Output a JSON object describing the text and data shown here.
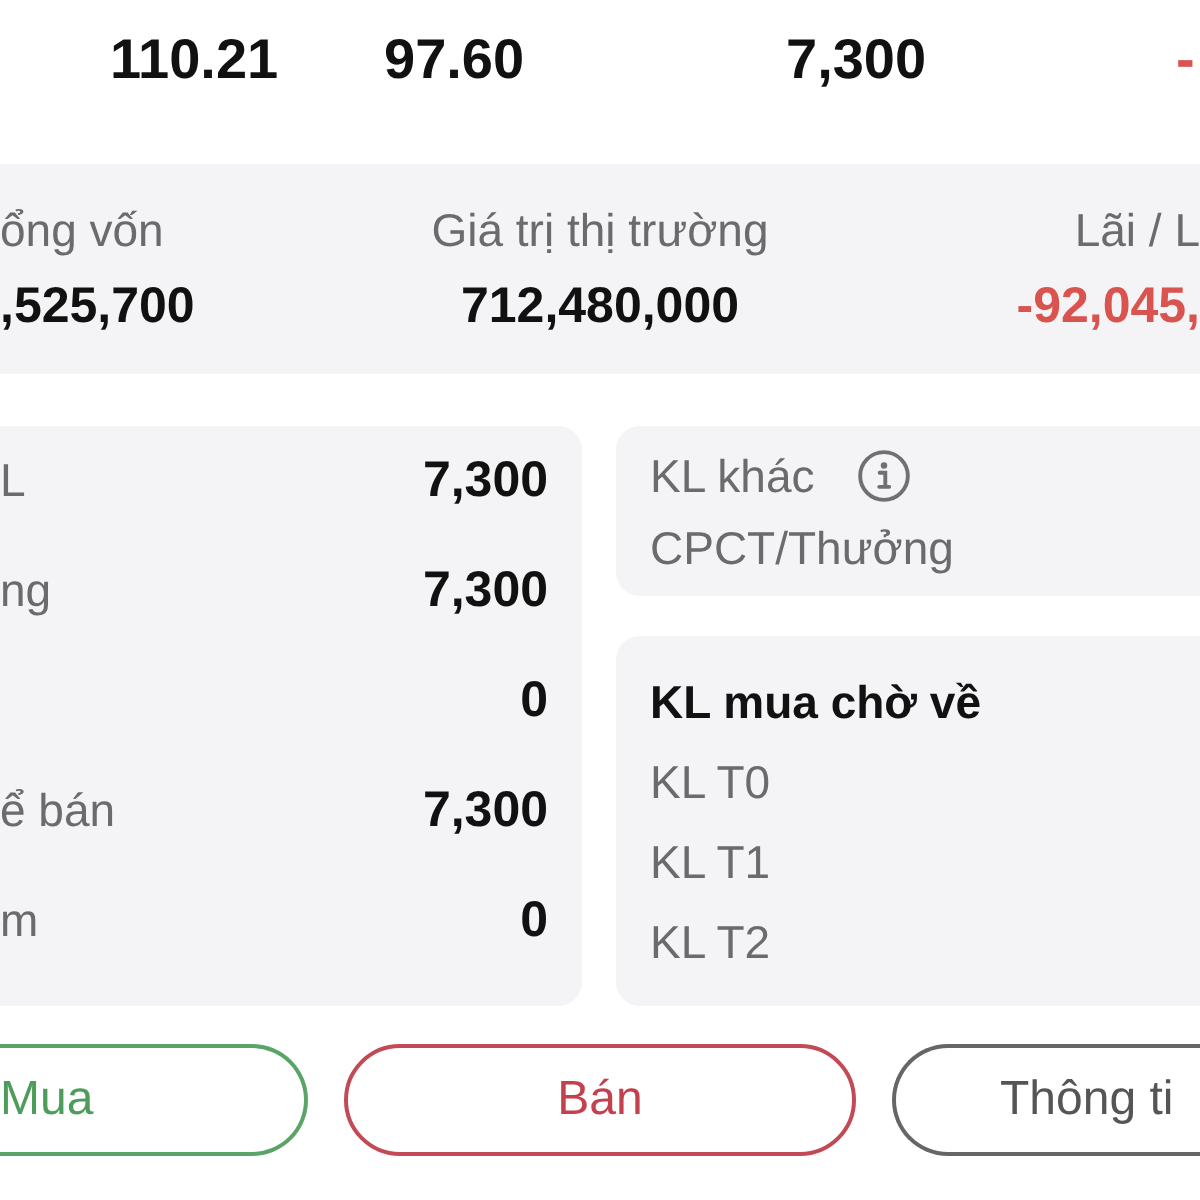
{
  "header_values": [
    {
      "text": "110.21",
      "negative": false
    },
    {
      "text": "97.60",
      "negative": false
    },
    {
      "text": "7,300",
      "negative": false
    },
    {
      "text": "-",
      "negative": true
    }
  ],
  "summary": [
    {
      "label": "ổng vốn",
      "value": ",525,700",
      "negative": false
    },
    {
      "label": "Giá trị thị trường",
      "value": "712,480,000",
      "negative": false
    },
    {
      "label": "Lãi / L",
      "value": "-92,045,",
      "negative": true
    }
  ],
  "holdings": [
    {
      "label": "L",
      "value": "7,300"
    },
    {
      "label": "ng",
      "value": "7,300"
    },
    {
      "value": "0"
    },
    {
      "label": "ể bán",
      "value": "7,300"
    },
    {
      "label": "m",
      "value": "0"
    }
  ],
  "other_volume": {
    "title": "KL khác",
    "rows": [
      "CPCT/Thưởng"
    ]
  },
  "pending_buy": {
    "title": "KL mua chờ về",
    "rows": [
      "KL T0",
      "KL T1",
      "KL T2"
    ]
  },
  "buttons": [
    {
      "label": "Mua",
      "kind": "buy"
    },
    {
      "label": "Bán",
      "kind": "sell"
    },
    {
      "label": "Thông ti",
      "kind": "info"
    }
  ]
}
